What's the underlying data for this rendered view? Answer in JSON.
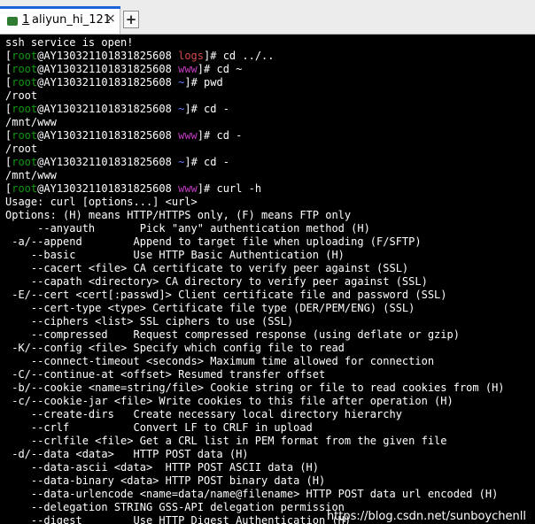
{
  "tab": {
    "number": "1",
    "title": "aliyun_hi_121",
    "close_glyph": "×",
    "new_tab_glyph": "+"
  },
  "prompt": {
    "open_bracket": "[",
    "user": "root",
    "at_host": "@AY130321101831825608",
    "close_bracket": "]",
    "suffix": "#"
  },
  "colors": {
    "user": "#0f9a0f",
    "dir_www": "#c13dc1",
    "dir_home": "#6f7bff",
    "dir_logs": "#d24a4a"
  },
  "terminal": {
    "lines": [
      {
        "kind": "text",
        "text": "ssh service is open!"
      },
      {
        "kind": "prompt",
        "dir": "logs",
        "dir_color": "red",
        "cmd": "cd ../.."
      },
      {
        "kind": "prompt",
        "dir": "www",
        "dir_color": "purple",
        "cmd": "cd ~"
      },
      {
        "kind": "prompt",
        "dir": "~",
        "dir_color": "blue",
        "cmd": "pwd"
      },
      {
        "kind": "text",
        "text": "/root"
      },
      {
        "kind": "prompt",
        "dir": "~",
        "dir_color": "blue",
        "cmd": "cd -"
      },
      {
        "kind": "text",
        "text": "/mnt/www"
      },
      {
        "kind": "prompt",
        "dir": "www",
        "dir_color": "purple",
        "cmd": "cd -"
      },
      {
        "kind": "text",
        "text": "/root"
      },
      {
        "kind": "prompt",
        "dir": "~",
        "dir_color": "blue",
        "cmd": "cd -"
      },
      {
        "kind": "text",
        "text": "/mnt/www"
      },
      {
        "kind": "prompt",
        "dir": "www",
        "dir_color": "purple",
        "cmd": "curl -h"
      },
      {
        "kind": "text",
        "text": "Usage: curl [options...] <url>"
      },
      {
        "kind": "text",
        "text": "Options: (H) means HTTP/HTTPS only, (F) means FTP only"
      },
      {
        "kind": "text",
        "text": "     --anyauth       Pick \"any\" authentication method (H)"
      },
      {
        "kind": "text",
        "text": " -a/--append        Append to target file when uploading (F/SFTP)"
      },
      {
        "kind": "text",
        "text": "    --basic         Use HTTP Basic Authentication (H)"
      },
      {
        "kind": "text",
        "text": "    --cacert <file> CA certificate to verify peer against (SSL)"
      },
      {
        "kind": "text",
        "text": "    --capath <directory> CA directory to verify peer against (SSL)"
      },
      {
        "kind": "text",
        "text": " -E/--cert <cert[:passwd]> Client certificate file and password (SSL)"
      },
      {
        "kind": "text",
        "text": "    --cert-type <type> Certificate file type (DER/PEM/ENG) (SSL)"
      },
      {
        "kind": "text",
        "text": "    --ciphers <list> SSL ciphers to use (SSL)"
      },
      {
        "kind": "text",
        "text": "    --compressed    Request compressed response (using deflate or gzip)"
      },
      {
        "kind": "text",
        "text": " -K/--config <file> Specify which config file to read"
      },
      {
        "kind": "text",
        "text": "    --connect-timeout <seconds> Maximum time allowed for connection"
      },
      {
        "kind": "text",
        "text": " -C/--continue-at <offset> Resumed transfer offset"
      },
      {
        "kind": "text",
        "text": " -b/--cookie <name=string/file> Cookie string or file to read cookies from (H)"
      },
      {
        "kind": "text",
        "text": " -c/--cookie-jar <file> Write cookies to this file after operation (H)"
      },
      {
        "kind": "text",
        "text": "    --create-dirs   Create necessary local directory hierarchy"
      },
      {
        "kind": "text",
        "text": "    --crlf          Convert LF to CRLF in upload"
      },
      {
        "kind": "text",
        "text": "    --crlfile <file> Get a CRL list in PEM format from the given file"
      },
      {
        "kind": "text",
        "text": " -d/--data <data>   HTTP POST data (H)"
      },
      {
        "kind": "text",
        "text": "    --data-ascii <data>  HTTP POST ASCII data (H)"
      },
      {
        "kind": "text",
        "text": "    --data-binary <data> HTTP POST binary data (H)"
      },
      {
        "kind": "text",
        "text": "    --data-urlencode <name=data/name@filename> HTTP POST data url encoded (H)"
      },
      {
        "kind": "text",
        "text": "    --delegation STRING GSS-API delegation permission"
      },
      {
        "kind": "text",
        "text": "    --digest        Use HTTP Digest Authentication (H)"
      }
    ]
  },
  "watermark": "https://blog.csdn.net/sunboychenll"
}
